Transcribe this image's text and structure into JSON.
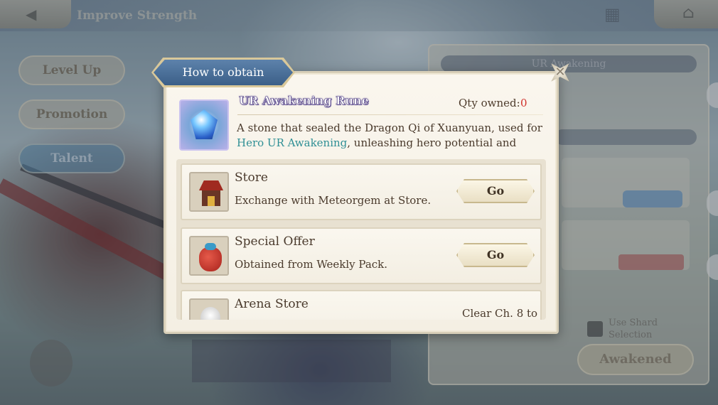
{
  "screen": {
    "title": "Improve Strength",
    "back_icon": "back-arrow-icon",
    "home_icon": "home-icon"
  },
  "side_menu": {
    "items": [
      {
        "label": "Level Up"
      },
      {
        "label": "Promotion"
      },
      {
        "label": "Talent"
      }
    ]
  },
  "right_panel": {
    "title": "UR Awakening",
    "awaken_button": "Awakened",
    "shard_checkbox_label": "Use Shard Selection"
  },
  "dialog": {
    "title": "How to obtain",
    "close_icon": "close-icon",
    "item": {
      "name": "UR Awakening Rune",
      "icon": "rune-gem-icon",
      "qty_label": "Qty owned:",
      "qty_value": "0",
      "description_part1": "A stone that sealed the Dragon Qi of Xuanyuan, used for ",
      "description_highlight": "Hero UR Awakening",
      "description_part2": ", unleashing hero potential and"
    },
    "sources": [
      {
        "title": "Store",
        "description": "Exchange with Meteorgem at Store.",
        "button": "Go",
        "icon": "store-icon"
      },
      {
        "title": "Special Offer",
        "description": "Obtained from Weekly Pack.",
        "button": "Go",
        "icon": "gift-bag-icon"
      },
      {
        "title": "Arena Store",
        "condition": "Clear Ch. 8 to",
        "icon": "arena-icon"
      }
    ]
  },
  "colors": {
    "dialog_tab": "#4a6f98",
    "qty_value": "#d0302a",
    "highlight_text": "#2f8f95",
    "body_text": "#4a3a2c"
  }
}
